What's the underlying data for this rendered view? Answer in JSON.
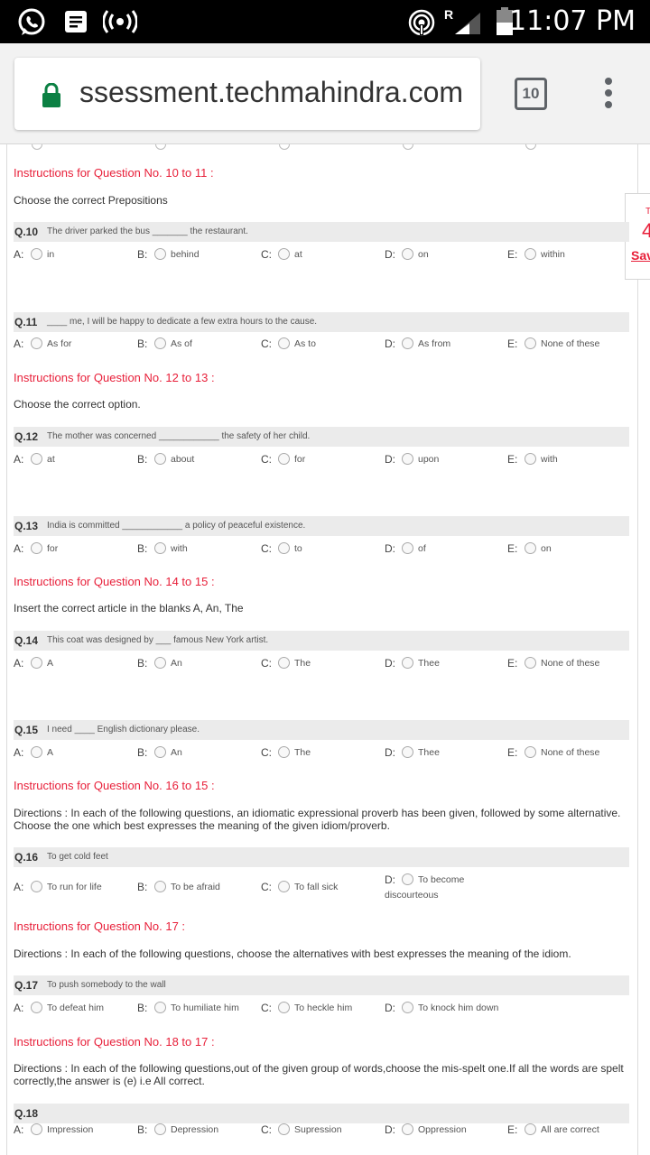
{
  "status_bar": {
    "time": "11:07 PM",
    "roaming": "R",
    "icons": [
      "whatsapp-icon",
      "notes-icon",
      "radio-wave-icon",
      "hotspot-icon",
      "signal-icon",
      "battery-icon"
    ]
  },
  "browser": {
    "url": "ssessment.techmahindra.com",
    "tab_count": "10",
    "icons": [
      "lock-icon",
      "menu-dots-icon"
    ]
  },
  "side_panel": {
    "line1": "T",
    "line2": "4",
    "save_label": "Sav"
  },
  "colors": {
    "instruction": "#e8203a",
    "question_bar": "#ebebeb"
  },
  "sections": [
    {
      "instruction": "Instructions for Question No. 10 to 11 :",
      "direction": "Choose the correct Prepositions"
    },
    {
      "instruction": "Instructions for Question No. 12 to 13 :",
      "direction": "Choose the correct option."
    },
    {
      "instruction": "Instructions for Question No. 14 to 15 :",
      "direction": "Insert the correct article in the blanks A, An, The"
    },
    {
      "instruction": "Instructions for Question No. 16 to 15 :",
      "direction": "Directions : In each of the following questions, an idiomatic expressional proverb has been given, followed by some alternative. Choose the one which best expresses the meaning of the given idiom/proverb."
    },
    {
      "instruction": "Instructions for Question No. 17 :",
      "direction": "Directions : In each of the following questions, choose the alternatives with best expresses the meaning of the idiom."
    },
    {
      "instruction": "Instructions for Question No. 18 to 17 :",
      "direction": "Directions : In each of the following questions,out of the given group of words,choose the mis-spelt one.If all the words are spelt correctly,the answer is (e) i.e All correct."
    }
  ],
  "questions": [
    {
      "num": "Q.10",
      "text": "The driver parked the bus _______ the restaurant.",
      "options": [
        {
          "letter": "A:",
          "text": "in"
        },
        {
          "letter": "B:",
          "text": "behind"
        },
        {
          "letter": "C:",
          "text": "at"
        },
        {
          "letter": "D:",
          "text": "on"
        },
        {
          "letter": "E:",
          "text": "within"
        }
      ]
    },
    {
      "num": "Q.11",
      "text": "____ me, I will be happy to dedicate a few extra hours to the cause.",
      "options": [
        {
          "letter": "A:",
          "text": "As for"
        },
        {
          "letter": "B:",
          "text": "As of"
        },
        {
          "letter": "C:",
          "text": "As to"
        },
        {
          "letter": "D:",
          "text": "As from"
        },
        {
          "letter": "E:",
          "text": "None of these"
        }
      ]
    },
    {
      "num": "Q.12",
      "text": "The mother was concerned ____________ the safety of her child.",
      "options": [
        {
          "letter": "A:",
          "text": "at"
        },
        {
          "letter": "B:",
          "text": "about"
        },
        {
          "letter": "C:",
          "text": "for"
        },
        {
          "letter": "D:",
          "text": "upon"
        },
        {
          "letter": "E:",
          "text": "with"
        }
      ]
    },
    {
      "num": "Q.13",
      "text": "India is committed ____________ a policy of peaceful existence.",
      "options": [
        {
          "letter": "A:",
          "text": "for"
        },
        {
          "letter": "B:",
          "text": "with"
        },
        {
          "letter": "C:",
          "text": "to"
        },
        {
          "letter": "D:",
          "text": "of"
        },
        {
          "letter": "E:",
          "text": "on"
        }
      ]
    },
    {
      "num": "Q.14",
      "text": "This coat was designed by ___ famous New York artist.",
      "options": [
        {
          "letter": "A:",
          "text": "A"
        },
        {
          "letter": "B:",
          "text": "An"
        },
        {
          "letter": "C:",
          "text": "The"
        },
        {
          "letter": "D:",
          "text": "Thee"
        },
        {
          "letter": "E:",
          "text": "None of these"
        }
      ]
    },
    {
      "num": "Q.15",
      "text": "I need ____ English dictionary please.",
      "options": [
        {
          "letter": "A:",
          "text": "A"
        },
        {
          "letter": "B:",
          "text": "An"
        },
        {
          "letter": "C:",
          "text": "The"
        },
        {
          "letter": "D:",
          "text": "Thee"
        },
        {
          "letter": "E:",
          "text": "None of these"
        }
      ]
    },
    {
      "num": "Q.16",
      "text": "To get cold feet",
      "options": [
        {
          "letter": "A:",
          "text": "To run for life"
        },
        {
          "letter": "B:",
          "text": "To be afraid"
        },
        {
          "letter": "C:",
          "text": "To fall sick"
        },
        {
          "letter": "D:",
          "text": "To become",
          "text2": "discourteous"
        }
      ]
    },
    {
      "num": "Q.17",
      "text": "To push somebody to the wall",
      "options": [
        {
          "letter": "A:",
          "text": "To defeat him"
        },
        {
          "letter": "B:",
          "text": "To humiliate him"
        },
        {
          "letter": "C:",
          "text": "To heckle him"
        },
        {
          "letter": "D:",
          "text": "To knock him down"
        }
      ]
    },
    {
      "num": "Q.18",
      "text": "",
      "options": [
        {
          "letter": "A:",
          "text": "Impression"
        },
        {
          "letter": "B:",
          "text": "Depression"
        },
        {
          "letter": "C:",
          "text": "Supression"
        },
        {
          "letter": "D:",
          "text": "Oppression"
        },
        {
          "letter": "E:",
          "text": "All are correct"
        }
      ]
    }
  ]
}
